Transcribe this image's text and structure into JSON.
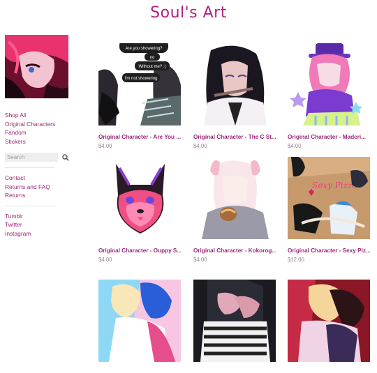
{
  "site": {
    "title": "Soul's Art"
  },
  "sidebar": {
    "shop_links": [
      "Shop All",
      "Original Characters",
      "Fandom",
      "Stickers"
    ],
    "search": {
      "placeholder": "Search"
    },
    "info_links": [
      "Contact",
      "Returns and FAQ",
      "Returns"
    ],
    "social_links": [
      "Tumblr",
      "Twitter",
      "Instagram"
    ]
  },
  "products": [
    {
      "name": "Original Character - Are You ...",
      "price": "$4.00",
      "speech": [
        "Are you showering?",
        "no",
        "Without me? :(",
        "I'm not showering"
      ]
    },
    {
      "name": "Original Character - The C St...",
      "price": "$4.00"
    },
    {
      "name": "Original Character - Madcri...",
      "price": "$4.00"
    },
    {
      "name": "Original Character - Ouppy S...",
      "price": "$4.00"
    },
    {
      "name": "Original Character - Kokorog...",
      "price": "$4.00"
    },
    {
      "name": "Original Character - Sexy Piz...",
      "price": "$12.00",
      "art_text": "Sexy Pizza"
    },
    {
      "name": "",
      "price": ""
    },
    {
      "name": "",
      "price": ""
    },
    {
      "name": "",
      "price": ""
    }
  ],
  "colors": {
    "accent": "#b0237e",
    "link": "#9c2778",
    "price": "#9a8a95"
  }
}
